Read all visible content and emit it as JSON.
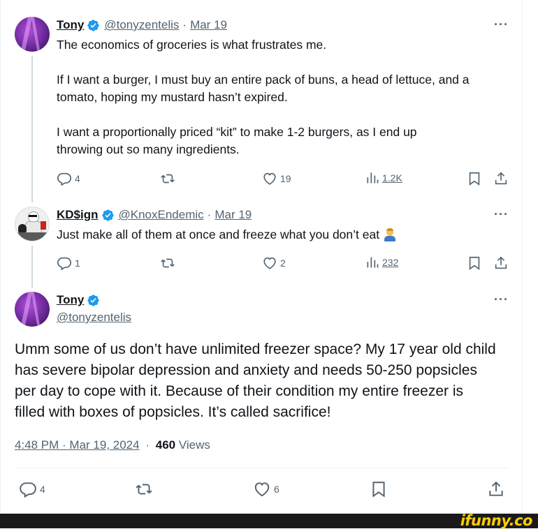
{
  "tweet1": {
    "name": "Tony",
    "handle": "@tonyzentelis",
    "date": "Mar 19",
    "more": "···",
    "line1": "The economics of groceries is what frustrates me.",
    "line2a": "If I want a burger, I must buy an entire pack of buns, a head of lettuce, and a",
    "line2b": "tomato, hoping my mustard hasn’t expired.",
    "line3a": "I want a proportionally priced “kit” to make 1-2 burgers, as I end up",
    "line3b": "throwing out so many ingredients.",
    "replies": "4",
    "likes": "19",
    "views": "1.2K"
  },
  "tweet2": {
    "name": "KD$ign",
    "handle": "@KnoxEndemic",
    "date": "Mar 19",
    "more": "···",
    "text": "Just make all of them at once and freeze what you don’t eat",
    "emoji_icon": "person-shrugging-emoji",
    "replies": "1",
    "likes": "2",
    "views": "232"
  },
  "main": {
    "name": "Tony",
    "handle": "@tonyzentelis",
    "more": "···",
    "line1": "Umm some of us don’t have unlimited freezer space? My 17 year old child",
    "line2": "has severe bipolar depression and anxiety and needs 50-250 popsicles",
    "line3": "per day to cope with it. Because of their condition my entire freezer is",
    "line4": "filled with boxes of popsicles. It’s called sacrifice!",
    "timestamp": "4:48 PM · Mar 19, 2024",
    "dot": "·",
    "view_count": "460",
    "views_label": "Views",
    "replies": "4",
    "likes": "6"
  },
  "watermark": "ifunny.co",
  "colors": {
    "verified": "#1d9bf0",
    "muted": "#536471",
    "text": "#0f1419",
    "watermark": "#ffcc00"
  }
}
